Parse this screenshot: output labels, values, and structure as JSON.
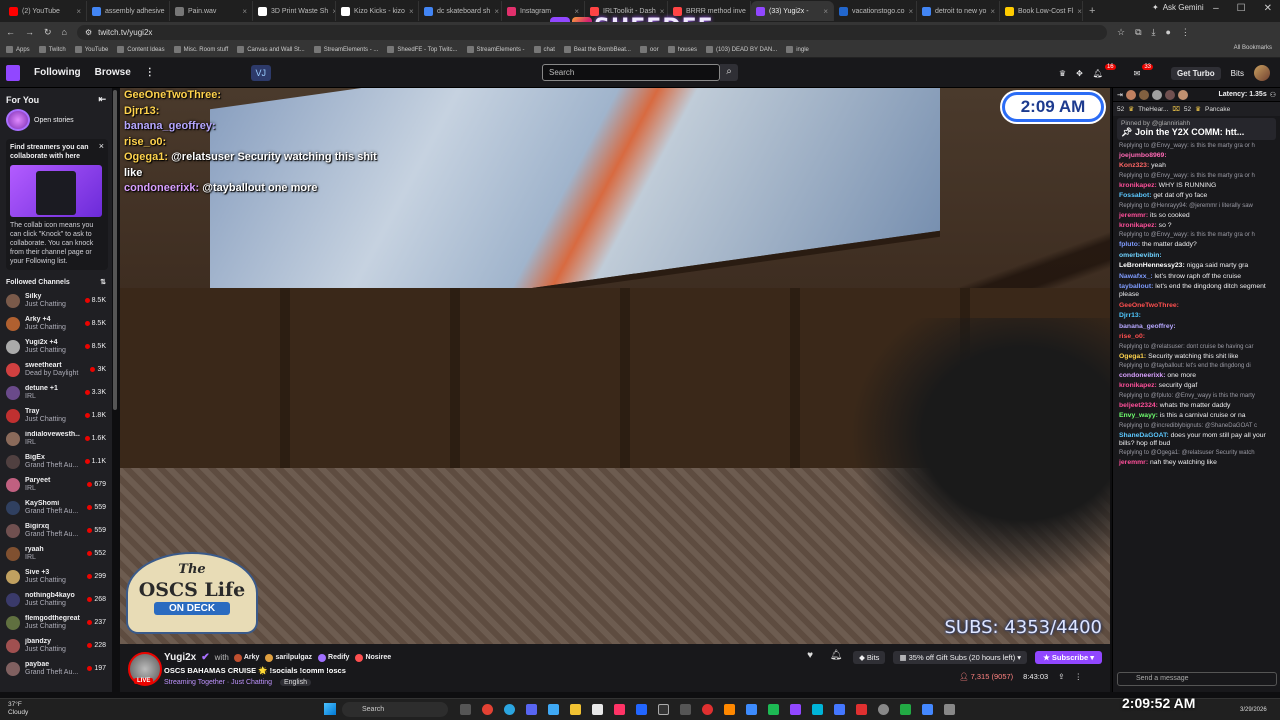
{
  "browser": {
    "tabs": [
      {
        "label": "(2) YouTube",
        "color": "#ff0000"
      },
      {
        "label": "assembly adhesive",
        "color": "#4285f4"
      },
      {
        "label": "Pain.wav",
        "color": "#777777"
      },
      {
        "label": "3D Print Waste Sh",
        "color": "#ffffff"
      },
      {
        "label": "Kizo Kicks - kizo",
        "color": "#ffffff"
      },
      {
        "label": "dc skateboard sh",
        "color": "#4285f4"
      },
      {
        "label": "Instagram",
        "color": "#e1306c"
      },
      {
        "label": "IRLToolkit - Dash",
        "color": "#ff4444"
      },
      {
        "label": "BRRR method inve",
        "color": "#ff4444"
      },
      {
        "label": "(33) Yugi2x -",
        "color": "#9147ff",
        "active": true
      },
      {
        "label": "vacationstogo.co",
        "color": "#2266cc"
      },
      {
        "label": "detroit to new yo",
        "color": "#4285f4"
      },
      {
        "label": "Book Low-Cost Fl",
        "color": "#ffcc00"
      }
    ],
    "new_tab": "+",
    "ask_gemini": "Ask Gemini",
    "url": "twitch.tv/yugi2x",
    "bookmarks": [
      "Apps",
      "Twitch",
      "YouTube",
      "Content Ideas",
      "Misc. Room stuff",
      "Canvas and Wall St...",
      "StreamElements - ...",
      "SheedFE - Top Twitc...",
      "StreamElements -",
      "chat",
      "Beat the BombBeat...",
      "oor",
      "houses",
      "(103) DEAD BY DAN...",
      "ingle"
    ],
    "all_bookmarks": "All Bookmarks"
  },
  "overlay_brand": "SHEEDFE",
  "twitch_nav": {
    "following": "Following",
    "browse": "Browse",
    "more": "⋮",
    "search_placeholder": "Search",
    "notif_count": "33",
    "whisper_count": "16",
    "turbo": "Get Turbo",
    "bits": "Bits"
  },
  "sidebar": {
    "for_you": "For You",
    "open_stories": "Open stories",
    "collab_title": "Find streamers you can collaborate with here",
    "collab_body": "The collab icon means you can click \"Knock\" to ask to collaborate. You can knock from their channel page or your Following list.",
    "followed_title": "Followed Channels",
    "channels": [
      {
        "name": "Silky",
        "game": "Just Chatting",
        "viewers": "8.5K",
        "color": "#7a5a4a"
      },
      {
        "name": "Arky +4",
        "game": "Just Chatting",
        "viewers": "8.5K",
        "color": "#b06030"
      },
      {
        "name": "Yugi2x +4",
        "game": "Just Chatting",
        "viewers": "8.5K",
        "color": "#aaaaaa"
      },
      {
        "name": "sweetheart",
        "game": "Dead by Daylight",
        "viewers": "3K",
        "color": "#d04040"
      },
      {
        "name": "detune +1",
        "game": "IRL",
        "viewers": "3.3K",
        "color": "#6a4a8a"
      },
      {
        "name": "Tray",
        "game": "Just Chatting",
        "viewers": "1.8K",
        "color": "#c03030"
      },
      {
        "name": "indialovewesth...",
        "game": "IRL",
        "viewers": "1.6K",
        "color": "#8a6a5a"
      },
      {
        "name": "BigEx",
        "game": "Grand Theft Au...",
        "viewers": "1.1K",
        "color": "#504040"
      },
      {
        "name": "Paryeet",
        "game": "IRL",
        "viewers": "679",
        "color": "#c06080"
      },
      {
        "name": "KayShomi",
        "game": "Grand Theft Au...",
        "viewers": "559",
        "color": "#304060"
      },
      {
        "name": "Bigirxq",
        "game": "Grand Theft Au...",
        "viewers": "559",
        "color": "#705050"
      },
      {
        "name": "ryaah",
        "game": "IRL",
        "viewers": "552",
        "color": "#805030"
      },
      {
        "name": "Sive +3",
        "game": "Just Chatting",
        "viewers": "299",
        "color": "#c0a060"
      },
      {
        "name": "nothingb4kayo",
        "game": "Just Chatting",
        "viewers": "268",
        "color": "#3a3a6a"
      },
      {
        "name": "flemgodthegreat",
        "game": "Just Chatting",
        "viewers": "237",
        "color": "#607040"
      },
      {
        "name": "jbandzy",
        "game": "Just Chatting",
        "viewers": "228",
        "color": "#a05050"
      },
      {
        "name": "paybae",
        "game": "Grand Theft Au...",
        "viewers": "197",
        "color": "#806060"
      }
    ]
  },
  "video": {
    "clock": "2:09 AM",
    "subs": "SUBS: 4353/4400",
    "logo_line1": "The",
    "logo_line2": "OSCS Life",
    "logo_line3": "ON DECK",
    "overlay_chat": [
      {
        "name": "GeeOneTwoThree:",
        "msg": "",
        "cls": ""
      },
      {
        "name": "Djrr13:",
        "msg": "",
        "cls": ""
      },
      {
        "name": "banana_geoffrey:",
        "msg": "",
        "cls": "b"
      },
      {
        "name": "rise_o0:",
        "msg": "",
        "cls": ""
      },
      {
        "name": "Ogega1:",
        "msg": "@relatsuser Security watching this shit like",
        "cls": ""
      },
      {
        "name": "condoneerixk:",
        "msg": "@tayballout one more",
        "cls": "c"
      }
    ]
  },
  "stream_info": {
    "streamer": "Yugi2x",
    "with": "with",
    "collaborators": [
      "Arky",
      "sarilpulgaz",
      "Redify",
      "Nosiree"
    ],
    "title": "OSCS BAHAMAS CRUISE 🌟 !socials !comm !oscs",
    "category": "Streaming Together · Just Chatting",
    "language": "English",
    "live": "LIVE",
    "bits": "Bits",
    "gift_offer": "35% off Gift Subs (20 hours left)",
    "subscribe": "Subscribe",
    "viewers": "7,315 (9057)",
    "uptime": "8:43:03"
  },
  "chat": {
    "latency": "Latency: 1.35s",
    "hype_count": "52",
    "hype_user": "TheHear...",
    "hype_count2": "52",
    "hype_user2": "Pancake",
    "pinned_by": "Pinned by @glanniriahh",
    "pinned_msg": "Join the Y2X COMM: htt...",
    "messages": [
      {
        "reply": "Replying to @Envy_wayy: is this the marty gra or h",
        "user": "joejumbo8969:",
        "color": "#ff69b4",
        "text": ""
      },
      {
        "reply": "",
        "user": "Konz323:",
        "color": "#ff6666",
        "text": " yeah"
      },
      {
        "reply": "Replying to @Envy_wayy: is this the marty gra or h",
        "user": "kronikapez:",
        "color": "#ff4f9a",
        "text": " WHY IS RUNNING"
      },
      {
        "reply": "",
        "user": "Fossabot:",
        "color": "#5cc8ff",
        "text": " get dat off yo face"
      },
      {
        "reply": "Replying to @Henrayy94: @jeremmr i literally saw",
        "user": "jeremmr:",
        "color": "#ff4f9a",
        "text": " its so cooked"
      },
      {
        "reply": "",
        "user": "kronikapez:",
        "color": "#ff4f9a",
        "text": " so ?"
      },
      {
        "reply": "Replying to @Envy_wayy: is this the marty gra or h",
        "user": "fpluto:",
        "color": "#7f9cff",
        "text": " the matter daddy?"
      },
      {
        "reply": "",
        "user": "omerbevibin:",
        "color": "#6fd2ff",
        "text": ""
      },
      {
        "reply": "",
        "user": "LeBronHennessy23:",
        "color": "#ffffff",
        "text": " nigga said marty gra"
      },
      {
        "reply": "",
        "user": "Nawafxx_:",
        "color": "#7f9cff",
        "text": " let's throw raph off the cruise"
      },
      {
        "reply": "",
        "user": "tayballout:",
        "color": "#7f9cff",
        "text": " let's end the dingdong ditch segment please"
      },
      {
        "reply": "",
        "user": "GeeOneTwoThree:",
        "color": "#ff4f4f",
        "text": ""
      },
      {
        "reply": "",
        "user": "Djrr13:",
        "color": "#4fc8ff",
        "text": ""
      },
      {
        "reply": "",
        "user": "banana_geoffrey:",
        "color": "#b6a7ff",
        "text": ""
      },
      {
        "reply": "",
        "user": "rise_o0:",
        "color": "#ff4f4f",
        "text": ""
      },
      {
        "reply": "Replying to @relatsuser: dont cruise be having car",
        "user": "Ogega1:",
        "color": "#ffd34d",
        "text": " Security watching this shit like"
      },
      {
        "reply": "Replying to @tayballout: let's end the dingdong di",
        "user": "condoneerixk:",
        "color": "#d9a0ff",
        "text": " one more"
      },
      {
        "reply": "",
        "user": "kronikapez:",
        "color": "#ff4f9a",
        "text": " security dgaf"
      },
      {
        "reply": "Replying to @fpluto: @Envy_wayy is this the marty",
        "user": "beljeet2324:",
        "color": "#ff4f9a",
        "text": " whats the matter daddy"
      },
      {
        "reply": "",
        "user": "Envy_wayy:",
        "color": "#6fff6f",
        "text": " is this a carnival cruise or na"
      },
      {
        "reply": "Replying to @incrediblybignuts: @ShaneDaGOAT c",
        "user": "ShaneDaGOAT:",
        "color": "#5cc8ff",
        "text": " does your mom still pay all your bills? hop off bud"
      },
      {
        "reply": "Replying to @Ogega1: @relatsuser Security watch",
        "user": "jeremmr:",
        "color": "#ff4f9a",
        "text": " nah they watching like"
      }
    ],
    "input_placeholder": "Send a message"
  },
  "taskbar": {
    "temp": "37°F",
    "weather": "Cloudy",
    "search": "Search",
    "time": "2:09:52 AM",
    "date": "3/29/2026"
  }
}
